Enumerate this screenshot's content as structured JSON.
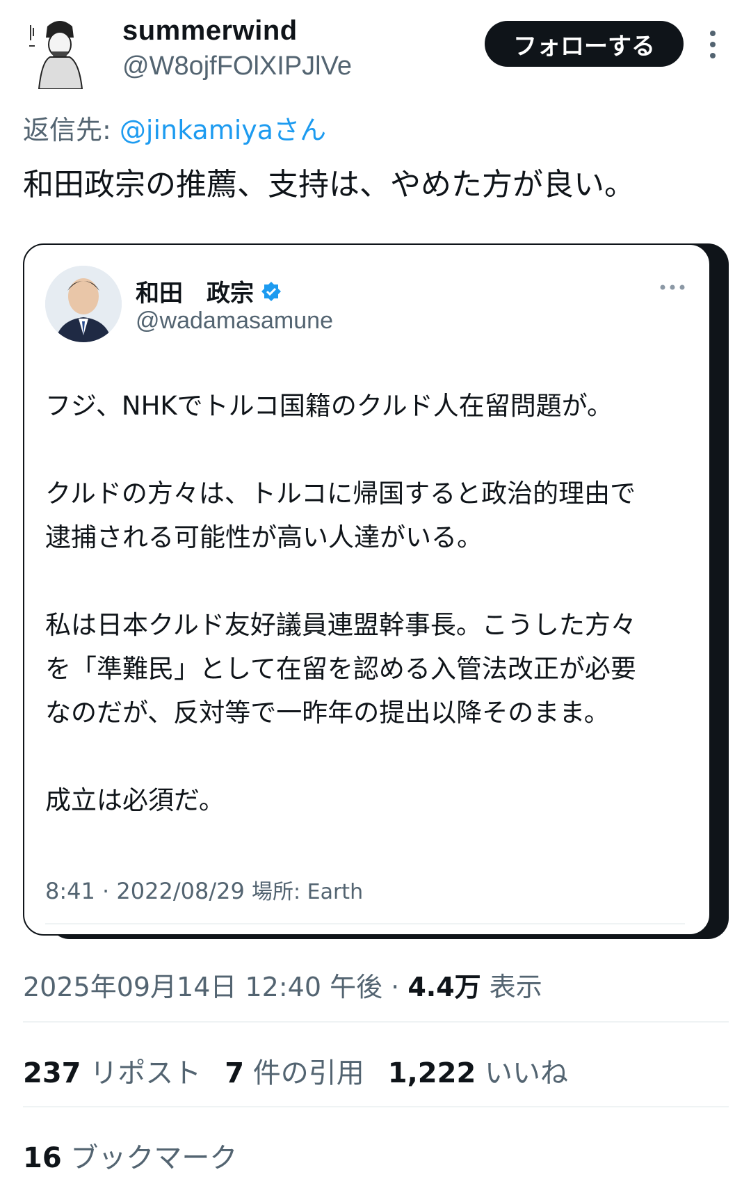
{
  "author": {
    "display_name": "summerwind",
    "handle": "@W8ojfFOlXIPJlVe",
    "follow_label": "フォローする"
  },
  "reply": {
    "prefix": "返信先: ",
    "mention": "@jinkamiyaさん"
  },
  "tweet": {
    "text": "和田政宗の推薦、支持は、やめた方が良い。"
  },
  "quoted": {
    "name": "和田　政宗",
    "handle": "@wadamasamune",
    "body": "フジ、NHKでトルコ国籍のクルド人在留問題が。\n\nクルドの方々は、トルコに帰国すると政治的理由で\n逮捕される可能性が高い人達がいる。\n\n私は日本クルド友好議員連盟幹事長。こうした方々\nを「準難民」として在留を認める入管法改正が必要\nなのだが、反対等で一昨年の提出以降そのまま。\n\n成立は必須だ。",
    "time": "8:41 · 2022/08/29 ",
    "location_label": "場所: Earth",
    "verified_color": "#1d9bf0"
  },
  "meta": {
    "datetime": "2025年09月14日 12:40 午後 · ",
    "views_count": "4.4万",
    "views_label": " 表示"
  },
  "stats": {
    "reposts_count": "237",
    "reposts_label": " リポスト",
    "quotes_count": "7",
    "quotes_label": " 件の引用",
    "likes_count": "1,222",
    "likes_label": " いいね",
    "bookmarks_count": "16",
    "bookmarks_label": " ブックマーク"
  },
  "colors": {
    "text": "#0f1419",
    "secondary": "#536471",
    "link": "#1d9bf0"
  }
}
